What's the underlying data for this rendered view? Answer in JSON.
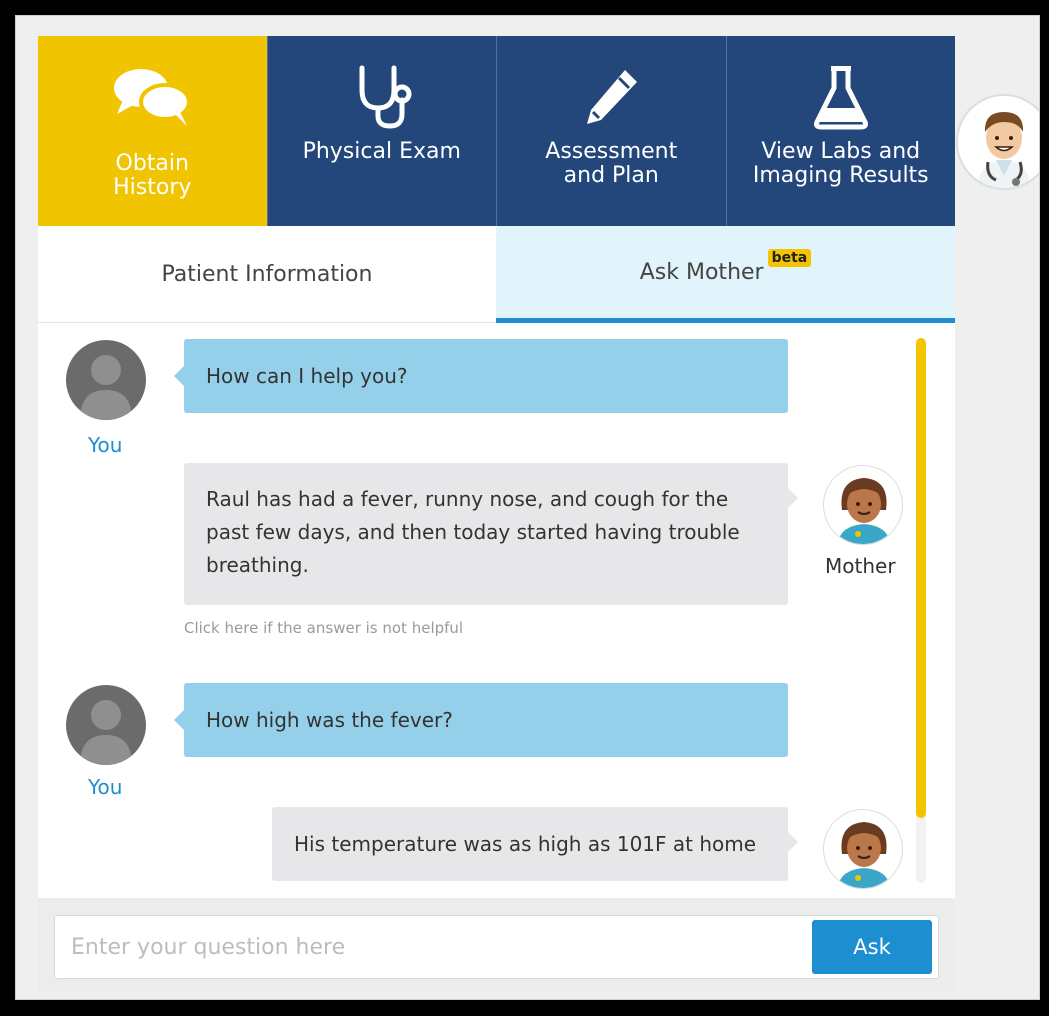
{
  "top_tabs": [
    {
      "label": "Obtain\nHistory",
      "icon": "speech-bubbles-icon",
      "active": true
    },
    {
      "label": "Physical Exam",
      "icon": "stethoscope-icon",
      "active": false
    },
    {
      "label": "Assessment\nand Plan",
      "icon": "pencil-icon",
      "active": false
    },
    {
      "label": "View Labs and\nImaging Results",
      "icon": "flask-icon",
      "active": false
    }
  ],
  "sub_tabs": {
    "patient_info": "Patient Information",
    "ask_mother": "Ask Mother",
    "beta": "beta"
  },
  "chat": {
    "you_label": "You",
    "mother_label": "Mother",
    "messages": [
      {
        "from": "You",
        "text": "How can I help you?"
      },
      {
        "from": "Mother",
        "text": "Raul has had a fever, runny nose, and cough for the past few days, and then today started having trouble breathing."
      },
      {
        "from": "You",
        "text": "How high was the fever?"
      },
      {
        "from": "Mother",
        "text": "His temperature was as high as 101F at home"
      }
    ],
    "not_helpful": "Click here if the answer is not helpful"
  },
  "input": {
    "placeholder": "Enter your question here",
    "value": "",
    "ask_label": "Ask"
  },
  "colors": {
    "nav_blue": "#23467b",
    "active_yellow": "#f0c400",
    "question_bubble": "#94d0ea",
    "answer_bubble": "#e7e7ea",
    "accent_blue": "#1d8fd1"
  }
}
